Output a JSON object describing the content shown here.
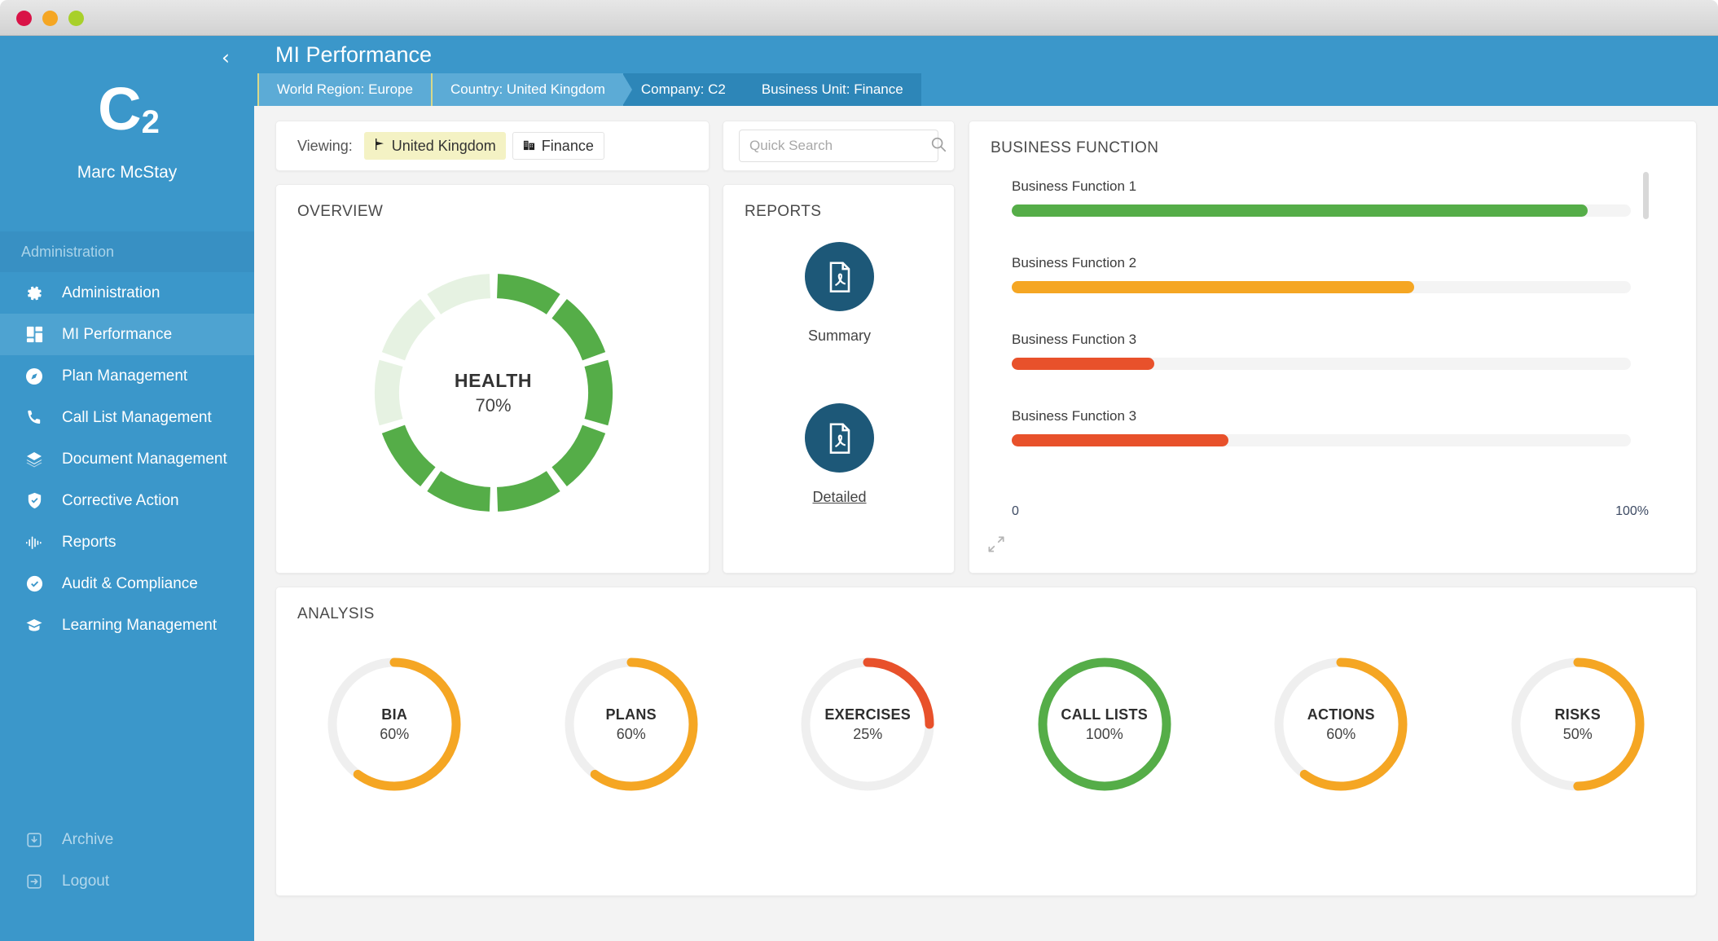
{
  "window": {
    "dots": [
      "close",
      "minimize",
      "maximize"
    ]
  },
  "sidebar": {
    "collapse_icon": "chevron-left-icon",
    "logo_main": "C",
    "logo_sub": "2",
    "user_name": "Marc McStay",
    "section_title": "Administration",
    "items": [
      {
        "label": "Administration",
        "icon": "gear-icon",
        "active": false
      },
      {
        "label": "MI Performance",
        "icon": "dashboard-icon",
        "active": true
      },
      {
        "label": "Plan Management",
        "icon": "compass-icon",
        "active": false
      },
      {
        "label": "Call List Management",
        "icon": "phone-icon",
        "active": false
      },
      {
        "label": "Document Management",
        "icon": "layers-icon",
        "active": false
      },
      {
        "label": "Corrective Action",
        "icon": "shield-check-icon",
        "active": false
      },
      {
        "label": "Reports",
        "icon": "waveform-icon",
        "active": false
      },
      {
        "label": "Audit & Compliance",
        "icon": "check-circle-icon",
        "active": false
      },
      {
        "label": "Learning Management",
        "icon": "graduation-icon",
        "active": false
      }
    ],
    "footer_items": [
      {
        "label": "Archive",
        "icon": "archive-icon"
      },
      {
        "label": "Logout",
        "icon": "logout-icon"
      }
    ]
  },
  "header": {
    "title": "MI Performance"
  },
  "breadcrumbs": [
    {
      "label": "World Region: Europe",
      "style": "light"
    },
    {
      "label": "Country: United Kingdom",
      "style": "light"
    },
    {
      "label": "Company: C2",
      "style": "dark"
    },
    {
      "label": "Business Unit: Finance",
      "style": "dark"
    }
  ],
  "viewing": {
    "label": "Viewing:",
    "chips": [
      {
        "text": "United Kingdom",
        "icon": "flag-icon",
        "style": "yellow"
      },
      {
        "text": "Finance",
        "icon": "building-icon",
        "style": "plain"
      }
    ]
  },
  "search": {
    "placeholder": "Quick Search",
    "value": "",
    "icon": "search-icon"
  },
  "overview": {
    "title": "OVERVIEW",
    "center_label": "HEALTH",
    "center_value": "70%"
  },
  "reports": {
    "title": "REPORTS",
    "items": [
      {
        "label": "Summary",
        "icon": "pdf-icon",
        "underlined": false
      },
      {
        "label": "Detailed",
        "icon": "pdf-icon",
        "underlined": true
      }
    ]
  },
  "business_function": {
    "title": "BUSINESS FUNCTION",
    "axis_min": "0",
    "axis_max": "100%",
    "expand_icon": "expand-icon"
  },
  "analysis": {
    "title": "ANALYSIS"
  },
  "colors": {
    "brand_blue": "#3b97ca",
    "breadcrumb_light": "#5cabd6",
    "breadcrumb_dark": "#2d86b8",
    "green": "#55ad48",
    "green_light": "#e6f2e2",
    "orange": "#f5a623",
    "red": "#e8512b",
    "track": "#f0f0f0",
    "report_circle": "#1d5878",
    "chip_yellow": "#f4f2c4"
  },
  "chart_data": [
    {
      "type": "pie",
      "name": "overview-health-donut",
      "title": "OVERVIEW",
      "center_label": "HEALTH",
      "center_value": "70%",
      "percent": 70,
      "segments_total": 10,
      "segments_filled": 7,
      "filled_color": "#55ad48",
      "empty_color": "#e6f2e2",
      "legend": "none"
    },
    {
      "type": "bar",
      "name": "business-function-bars",
      "title": "BUSINESS FUNCTION",
      "orientation": "horizontal",
      "categories": [
        "Business Function 1",
        "Business Function 2",
        "Business Function 3",
        "Business Function 3"
      ],
      "values": [
        93,
        65,
        23,
        35
      ],
      "colors": [
        "#55ad48",
        "#f5a623",
        "#e8512b",
        "#e8512b"
      ],
      "xlim": [
        0,
        100
      ],
      "xlabel": "",
      "ylabel": "",
      "tick_labels": [
        "0",
        "100%"
      ],
      "grid": false,
      "legend": "none",
      "scrollable": true
    },
    {
      "type": "pie",
      "name": "analysis-gauges",
      "title": "ANALYSIS",
      "subtype": "radial-gauges",
      "categories": [
        "BIA",
        "PLANS",
        "EXERCISES",
        "CALL LISTS",
        "ACTIONS",
        "RISKS"
      ],
      "values": [
        60,
        60,
        25,
        100,
        60,
        50
      ],
      "value_labels": [
        "60%",
        "60%",
        "25%",
        "100%",
        "60%",
        "50%"
      ],
      "colors": [
        "#f5a623",
        "#f5a623",
        "#e8512b",
        "#55ad48",
        "#f5a623",
        "#f5a623"
      ],
      "track_color": "#efefef",
      "ylim": [
        0,
        100
      ],
      "legend": "none"
    }
  ]
}
